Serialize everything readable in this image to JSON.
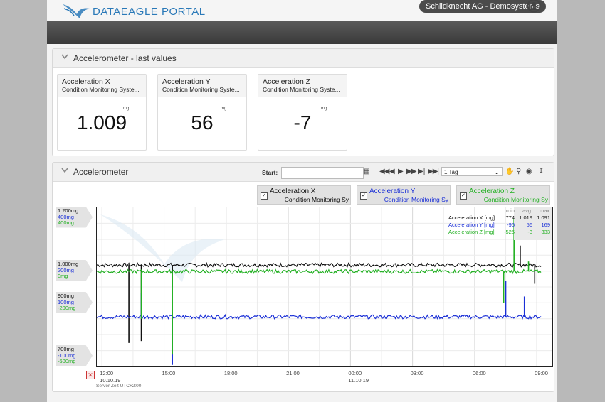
{
  "header": {
    "logo_text": "DATAEAGLE PORTAL",
    "company": "Schildknecht AG - Demosystems"
  },
  "last_values": {
    "title": "Accelerometer - last values",
    "tiles": [
      {
        "name": "Acceleration X",
        "source": "Condition Monitoring Syste...",
        "unit": "mg",
        "value": "1.009"
      },
      {
        "name": "Acceleration Y",
        "source": "Condition Monitoring Syste...",
        "unit": "mg",
        "value": "56"
      },
      {
        "name": "Acceleration Z",
        "source": "Condition Monitoring Syste...",
        "unit": "mg",
        "value": "-7"
      }
    ]
  },
  "chart_panel": {
    "title": "Accelerometer",
    "start_label": "Start:",
    "start_value": "",
    "range": "1 Tag",
    "legend": [
      {
        "name": "Acceleration X",
        "source": "Condition Monitoring Sy",
        "color": "#111111",
        "checked": true
      },
      {
        "name": "Acceleration Y",
        "source": "Condition Monitoring Sy",
        "color": "#1a2fd6",
        "checked": true
      },
      {
        "name": "Acceleration Z",
        "source": "Condition Monitoring Sy",
        "color": "#22b022",
        "checked": true
      }
    ],
    "y_labels": [
      [
        "1.200mg",
        "400mg",
        "400mg"
      ],
      [
        "1.000mg",
        "200mg",
        "0mg"
      ],
      [
        "900mg",
        "100mg",
        "-200mg"
      ],
      [
        "700mg",
        "-100mg",
        "-600mg"
      ]
    ],
    "stats_header": [
      "min",
      "avg",
      "max"
    ],
    "stats": [
      {
        "label": "Acceleration X [mg]",
        "min": "774",
        "avg": "1.019",
        "max": "1.091",
        "color": "#111111"
      },
      {
        "label": "Acceleration Y [mg]",
        "min": "-95",
        "avg": "56",
        "max": "169",
        "color": "#1a2fd6"
      },
      {
        "label": "Acceleration Z [mg]",
        "min": "-525",
        "avg": "-3",
        "max": "333",
        "color": "#22b022"
      }
    ],
    "x_ticks": [
      {
        "time": "12:00",
        "date": "10.10.19"
      },
      {
        "time": "15:00",
        "date": ""
      },
      {
        "time": "18:00",
        "date": ""
      },
      {
        "time": "21:00",
        "date": ""
      },
      {
        "time": "00:00",
        "date": "11.10.19"
      },
      {
        "time": "03:00",
        "date": ""
      },
      {
        "time": "06:00",
        "date": ""
      },
      {
        "time": "09:00",
        "date": ""
      }
    ],
    "server_time": "Server Zeit UTC+2:00"
  },
  "chart_data": {
    "type": "line",
    "x_range_hours": [
      11.75,
      33.75
    ],
    "series": [
      {
        "name": "Acceleration X",
        "unit": "mg",
        "ylim": [
          700,
          1200
        ],
        "avg": 1019,
        "min": 774,
        "max": 1091,
        "spikes": [
          {
            "x": 13.3,
            "y": 774
          },
          {
            "x": 13.9,
            "y": 780
          },
          {
            "x": 15.4,
            "y": 950
          },
          {
            "x": 32.2,
            "y": 1080
          },
          {
            "x": 32.9,
            "y": 960
          }
        ]
      },
      {
        "name": "Acceleration Y",
        "unit": "mg",
        "ylim": [
          -100,
          400
        ],
        "avg": 56,
        "min": -95,
        "max": 169,
        "spikes": [
          {
            "x": 13.9,
            "y": 130
          },
          {
            "x": 15.4,
            "y": -95
          },
          {
            "x": 31.5,
            "y": 169
          },
          {
            "x": 32.4,
            "y": 120
          }
        ]
      },
      {
        "name": "Acceleration Z",
        "unit": "mg",
        "ylim": [
          -600,
          400
        ],
        "avg": -3,
        "min": -525,
        "max": 333,
        "spikes": [
          {
            "x": 13.9,
            "y": -300
          },
          {
            "x": 15.4,
            "y": -525
          },
          {
            "x": 31.4,
            "y": -200
          },
          {
            "x": 31.9,
            "y": 333
          },
          {
            "x": 32.6,
            "y": 60
          }
        ]
      }
    ],
    "grid": true
  }
}
